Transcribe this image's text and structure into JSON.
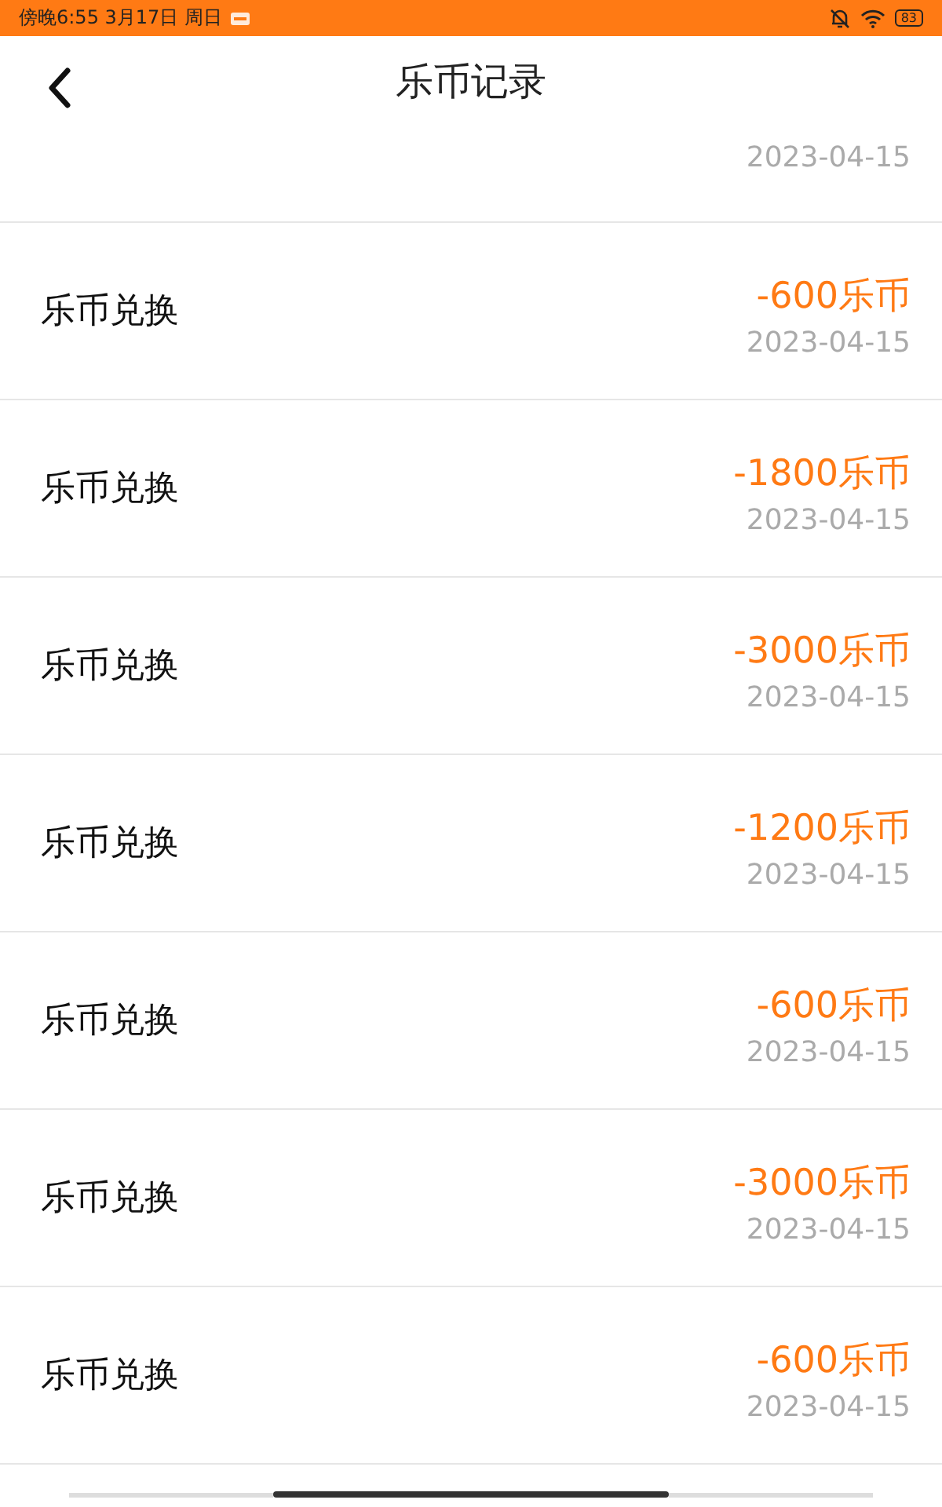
{
  "status_bar": {
    "time": "傍晚6:55 3月17日 周日",
    "battery": "83"
  },
  "header": {
    "title": "乐币记录"
  },
  "partial_record": {
    "date": "2023-04-15"
  },
  "records": [
    {
      "title": "乐币兑换",
      "amount": "-600乐币",
      "date": "2023-04-15"
    },
    {
      "title": "乐币兑换",
      "amount": "-1800乐币",
      "date": "2023-04-15"
    },
    {
      "title": "乐币兑换",
      "amount": "-3000乐币",
      "date": "2023-04-15"
    },
    {
      "title": "乐币兑换",
      "amount": "-1200乐币",
      "date": "2023-04-15"
    },
    {
      "title": "乐币兑换",
      "amount": "-600乐币",
      "date": "2023-04-15"
    },
    {
      "title": "乐币兑换",
      "amount": "-3000乐币",
      "date": "2023-04-15"
    },
    {
      "title": "乐币兑换",
      "amount": "-600乐币",
      "date": "2023-04-15"
    }
  ]
}
